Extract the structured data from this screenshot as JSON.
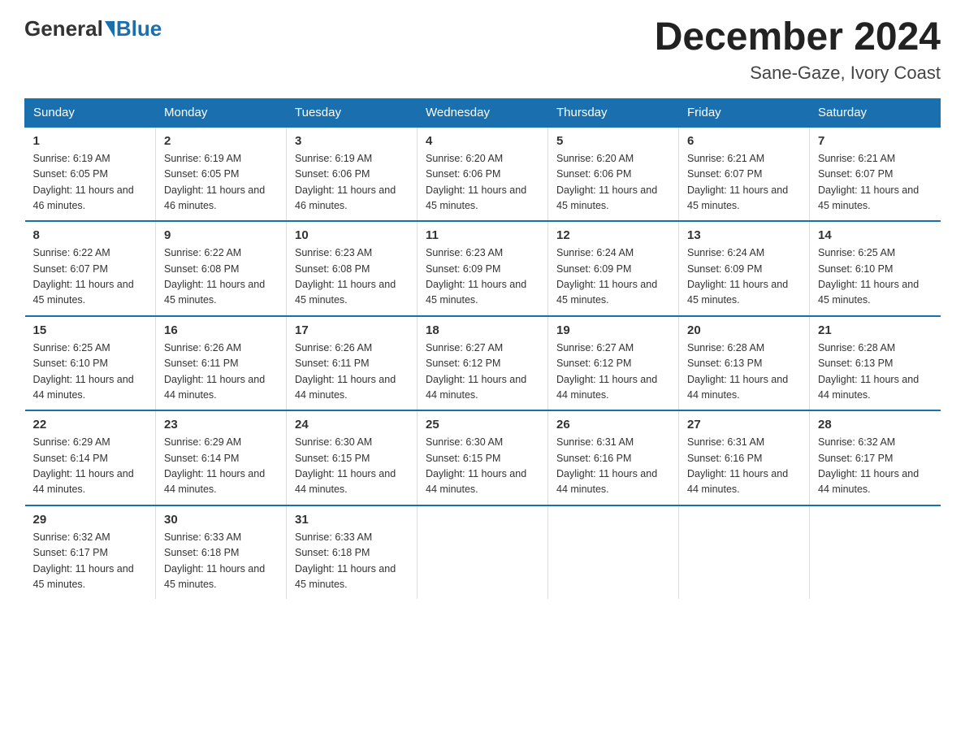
{
  "logo": {
    "text_before": "General",
    "text_after": "Blue"
  },
  "header": {
    "month_year": "December 2024",
    "location": "Sane-Gaze, Ivory Coast"
  },
  "days_of_week": [
    "Sunday",
    "Monday",
    "Tuesday",
    "Wednesday",
    "Thursday",
    "Friday",
    "Saturday"
  ],
  "weeks": [
    [
      {
        "day": 1,
        "sunrise": "6:19 AM",
        "sunset": "6:05 PM",
        "daylight": "11 hours and 46 minutes."
      },
      {
        "day": 2,
        "sunrise": "6:19 AM",
        "sunset": "6:05 PM",
        "daylight": "11 hours and 46 minutes."
      },
      {
        "day": 3,
        "sunrise": "6:19 AM",
        "sunset": "6:06 PM",
        "daylight": "11 hours and 46 minutes."
      },
      {
        "day": 4,
        "sunrise": "6:20 AM",
        "sunset": "6:06 PM",
        "daylight": "11 hours and 45 minutes."
      },
      {
        "day": 5,
        "sunrise": "6:20 AM",
        "sunset": "6:06 PM",
        "daylight": "11 hours and 45 minutes."
      },
      {
        "day": 6,
        "sunrise": "6:21 AM",
        "sunset": "6:07 PM",
        "daylight": "11 hours and 45 minutes."
      },
      {
        "day": 7,
        "sunrise": "6:21 AM",
        "sunset": "6:07 PM",
        "daylight": "11 hours and 45 minutes."
      }
    ],
    [
      {
        "day": 8,
        "sunrise": "6:22 AM",
        "sunset": "6:07 PM",
        "daylight": "11 hours and 45 minutes."
      },
      {
        "day": 9,
        "sunrise": "6:22 AM",
        "sunset": "6:08 PM",
        "daylight": "11 hours and 45 minutes."
      },
      {
        "day": 10,
        "sunrise": "6:23 AM",
        "sunset": "6:08 PM",
        "daylight": "11 hours and 45 minutes."
      },
      {
        "day": 11,
        "sunrise": "6:23 AM",
        "sunset": "6:09 PM",
        "daylight": "11 hours and 45 minutes."
      },
      {
        "day": 12,
        "sunrise": "6:24 AM",
        "sunset": "6:09 PM",
        "daylight": "11 hours and 45 minutes."
      },
      {
        "day": 13,
        "sunrise": "6:24 AM",
        "sunset": "6:09 PM",
        "daylight": "11 hours and 45 minutes."
      },
      {
        "day": 14,
        "sunrise": "6:25 AM",
        "sunset": "6:10 PM",
        "daylight": "11 hours and 45 minutes."
      }
    ],
    [
      {
        "day": 15,
        "sunrise": "6:25 AM",
        "sunset": "6:10 PM",
        "daylight": "11 hours and 44 minutes."
      },
      {
        "day": 16,
        "sunrise": "6:26 AM",
        "sunset": "6:11 PM",
        "daylight": "11 hours and 44 minutes."
      },
      {
        "day": 17,
        "sunrise": "6:26 AM",
        "sunset": "6:11 PM",
        "daylight": "11 hours and 44 minutes."
      },
      {
        "day": 18,
        "sunrise": "6:27 AM",
        "sunset": "6:12 PM",
        "daylight": "11 hours and 44 minutes."
      },
      {
        "day": 19,
        "sunrise": "6:27 AM",
        "sunset": "6:12 PM",
        "daylight": "11 hours and 44 minutes."
      },
      {
        "day": 20,
        "sunrise": "6:28 AM",
        "sunset": "6:13 PM",
        "daylight": "11 hours and 44 minutes."
      },
      {
        "day": 21,
        "sunrise": "6:28 AM",
        "sunset": "6:13 PM",
        "daylight": "11 hours and 44 minutes."
      }
    ],
    [
      {
        "day": 22,
        "sunrise": "6:29 AM",
        "sunset": "6:14 PM",
        "daylight": "11 hours and 44 minutes."
      },
      {
        "day": 23,
        "sunrise": "6:29 AM",
        "sunset": "6:14 PM",
        "daylight": "11 hours and 44 minutes."
      },
      {
        "day": 24,
        "sunrise": "6:30 AM",
        "sunset": "6:15 PM",
        "daylight": "11 hours and 44 minutes."
      },
      {
        "day": 25,
        "sunrise": "6:30 AM",
        "sunset": "6:15 PM",
        "daylight": "11 hours and 44 minutes."
      },
      {
        "day": 26,
        "sunrise": "6:31 AM",
        "sunset": "6:16 PM",
        "daylight": "11 hours and 44 minutes."
      },
      {
        "day": 27,
        "sunrise": "6:31 AM",
        "sunset": "6:16 PM",
        "daylight": "11 hours and 44 minutes."
      },
      {
        "day": 28,
        "sunrise": "6:32 AM",
        "sunset": "6:17 PM",
        "daylight": "11 hours and 44 minutes."
      }
    ],
    [
      {
        "day": 29,
        "sunrise": "6:32 AM",
        "sunset": "6:17 PM",
        "daylight": "11 hours and 45 minutes."
      },
      {
        "day": 30,
        "sunrise": "6:33 AM",
        "sunset": "6:18 PM",
        "daylight": "11 hours and 45 minutes."
      },
      {
        "day": 31,
        "sunrise": "6:33 AM",
        "sunset": "6:18 PM",
        "daylight": "11 hours and 45 minutes."
      },
      null,
      null,
      null,
      null
    ]
  ]
}
